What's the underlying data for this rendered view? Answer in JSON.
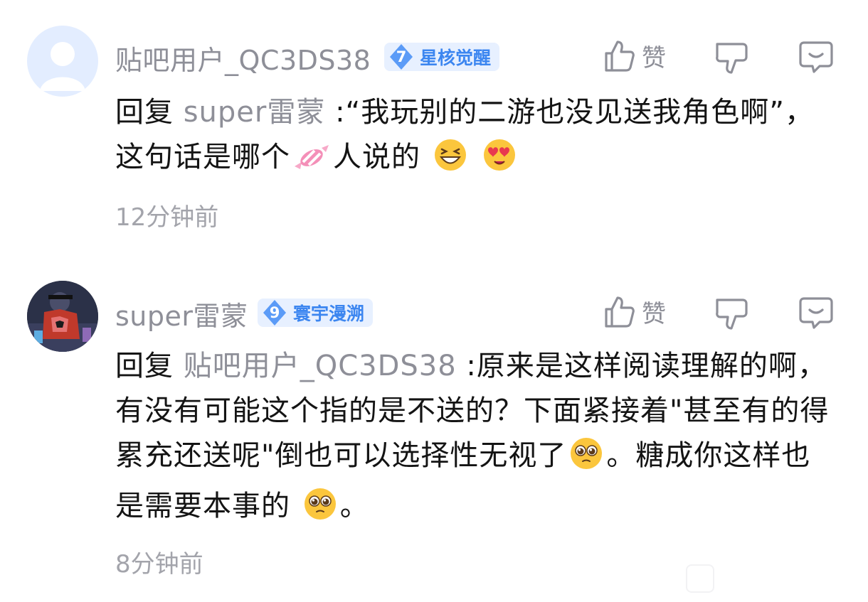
{
  "comments": [
    {
      "username": "贴吧用户_QC3DS38",
      "badge_level": "7",
      "badge_title": "星核觉醒",
      "like_label": "赞",
      "reply_keyword": "回复",
      "reply_to": "super雷蒙",
      "text_part1": " :“我玩别的二游也没见送我角色啊”，这句话是哪个",
      "emoji_1": "candy-emoji",
      "text_part2": "人说的",
      "emoji_2": "grinning-squint-emoji",
      "emoji_3": "heart-eyes-emoji",
      "time": "12分钟前"
    },
    {
      "username": "super雷蒙",
      "badge_level": "9",
      "badge_title": "寰宇漫溯",
      "like_label": "赞",
      "reply_keyword": "回复",
      "reply_to": "贴吧用户_QC3DS38",
      "text_part1": " :原来是这样阅读理解的啊，有没有可能这个指的是不送的？下面紧接着\"甚至有的得累充还送呢\"倒也可以选择性无视了",
      "emoji_1": "pleading-face-emoji",
      "text_part2": "。糖成你这样也是需要本事的",
      "emoji_2": "pleading-face-emoji",
      "text_part3": "。",
      "time": "8分钟前"
    }
  ],
  "colors": {
    "username": "#8e8f98",
    "badge_bg": "#e7f0ff",
    "badge_text": "#3c86f0",
    "body_text": "#141414",
    "time": "#a3a4ab"
  }
}
